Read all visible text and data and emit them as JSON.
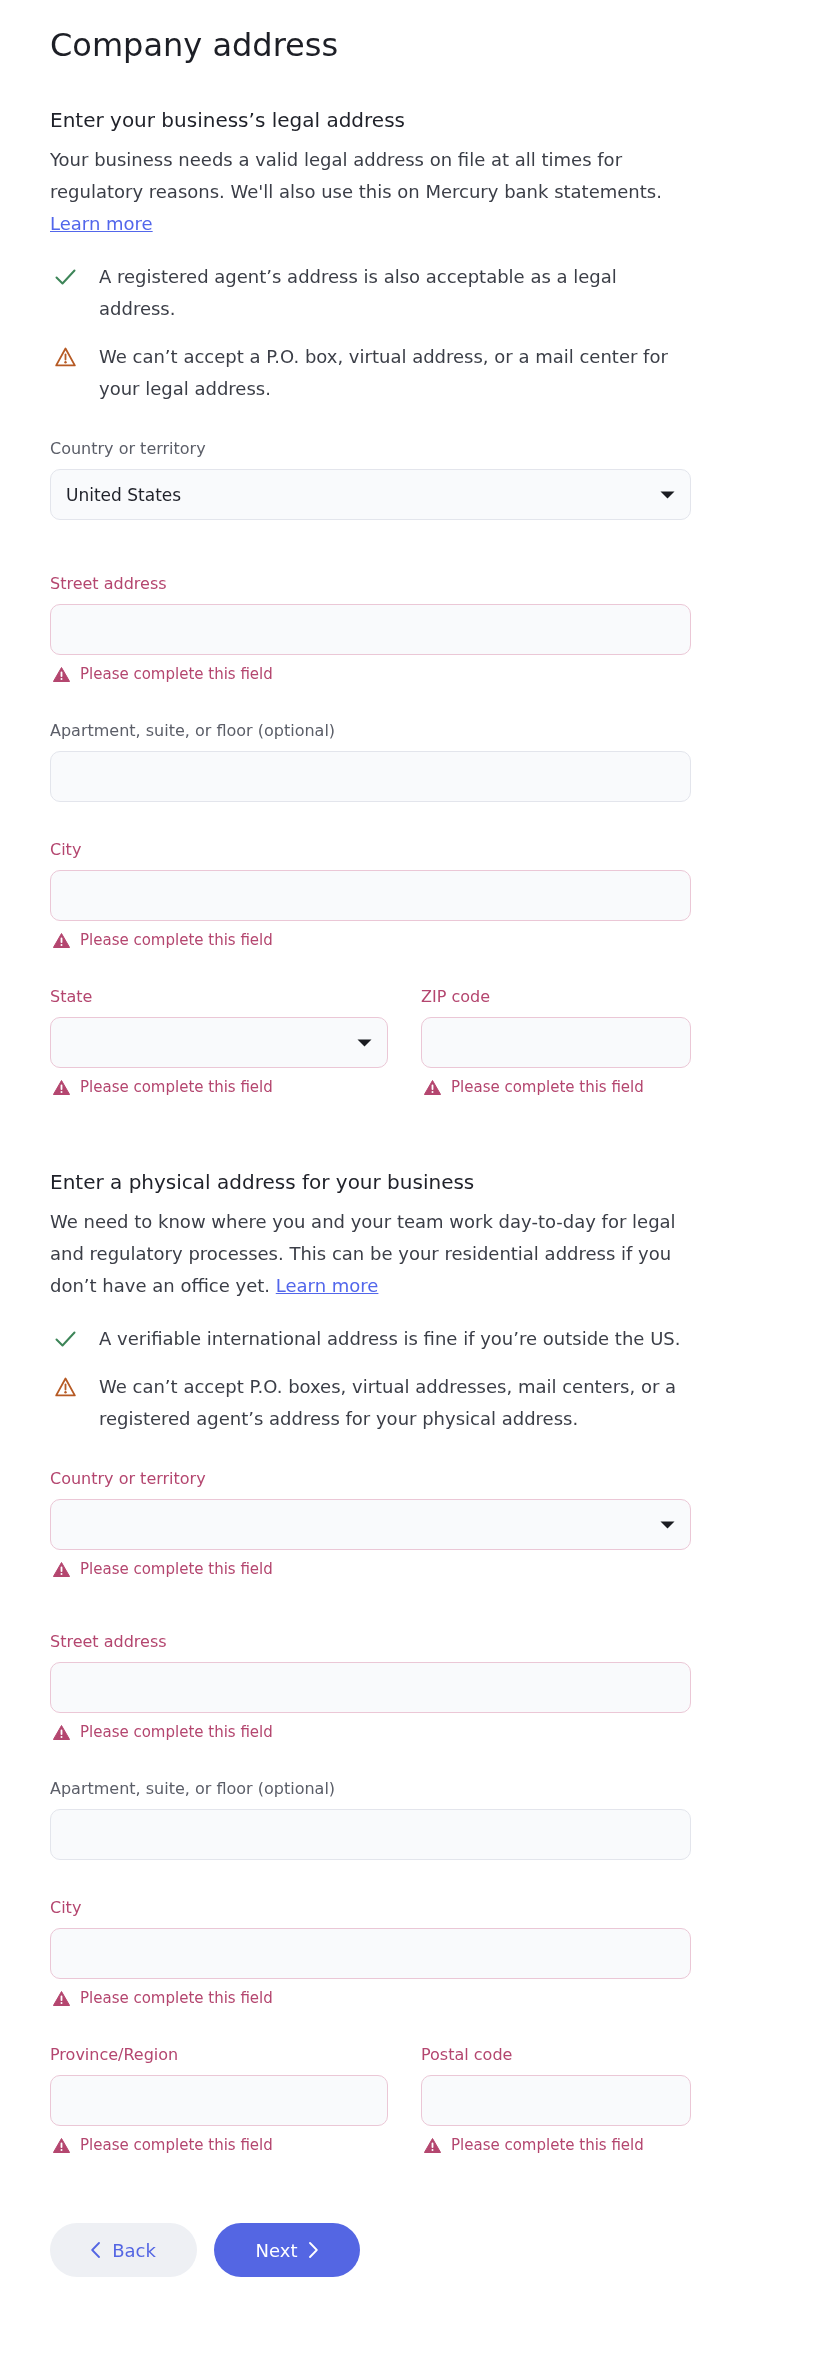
{
  "page": {
    "title": "Company address"
  },
  "sections": [
    {
      "heading": "Enter your business’s legal address",
      "description": "Your business needs a valid legal address on file at all times for regulatory reasons. We'll also use this on Mercury bank statements.",
      "link": "Learn more",
      "notes": [
        {
          "kind": "ok",
          "text": "A registered agent’s address is also acceptable as a legal address."
        },
        {
          "kind": "warning",
          "text": "We can’t accept a P.O. box, virtual address, or a mail center for your legal address."
        }
      ],
      "rows": [
        [
          {
            "kind": "select",
            "label": "Country or territory",
            "value": "United States",
            "invalid": false
          }
        ],
        [
          {
            "kind": "text",
            "label": "Street address",
            "invalid": true,
            "error": "Please complete this field"
          }
        ],
        [
          {
            "kind": "text",
            "label": "Apartment, suite, or floor (optional)",
            "invalid": false
          }
        ],
        [
          {
            "kind": "text",
            "label": "City",
            "invalid": true,
            "error": "Please complete this field"
          }
        ],
        [
          {
            "kind": "select",
            "label": "State",
            "invalid": true,
            "error": "Please complete this field"
          },
          {
            "kind": "text",
            "label": "ZIP code",
            "invalid": true,
            "error": "Please complete this field"
          }
        ]
      ]
    },
    {
      "heading": "Enter a physical address for your business",
      "description": "We need to know where you and your team work day-to-day for legal and regulatory processes. This can be your residential address if you don’t have an office yet.",
      "link": "Learn more",
      "notes": [
        {
          "kind": "ok",
          "text": "A verifiable international address is fine if you’re outside the US."
        },
        {
          "kind": "warning",
          "text": "We can’t accept P.O. boxes, virtual addresses, mail centers, or a registered agent’s address for your physical address."
        }
      ],
      "rows": [
        [
          {
            "kind": "select",
            "label": "Country or territory",
            "invalid": true,
            "error": "Please complete this field"
          }
        ],
        [
          {
            "kind": "text",
            "label": "Street address",
            "invalid": true,
            "error": "Please complete this field"
          }
        ],
        [
          {
            "kind": "text",
            "label": "Apartment, suite, or floor (optional)",
            "invalid": false
          }
        ],
        [
          {
            "kind": "text",
            "label": "City",
            "invalid": true,
            "error": "Please complete this field"
          }
        ],
        [
          {
            "kind": "text",
            "label": "Province/Region",
            "invalid": true,
            "error": "Please complete this field"
          },
          {
            "kind": "text",
            "label": "Postal code",
            "invalid": true,
            "error": "Please complete this field"
          }
        ]
      ]
    }
  ],
  "buttons": [
    {
      "kind": "back",
      "label": "Back"
    },
    {
      "kind": "next",
      "label": "Next"
    }
  ]
}
